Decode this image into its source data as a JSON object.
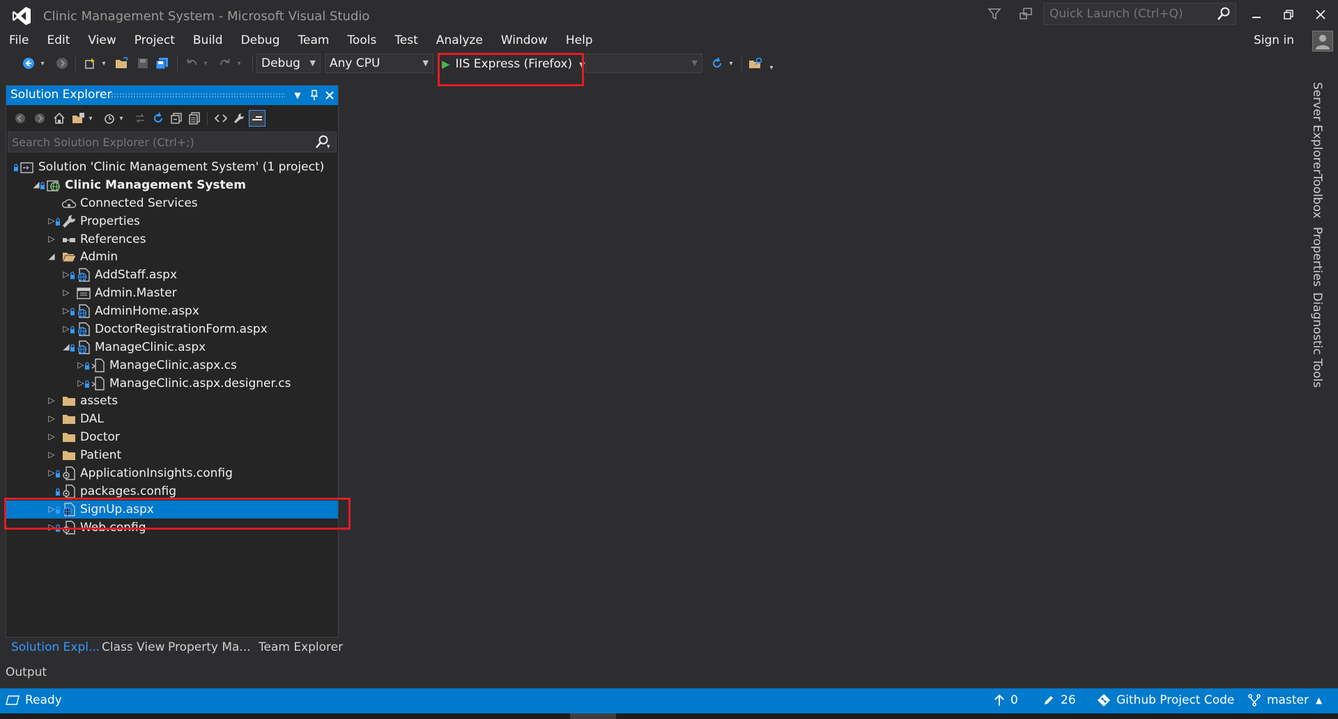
{
  "window": {
    "title": "Clinic Management System - Microsoft Visual Studio",
    "quick_launch_placeholder": "Quick Launch (Ctrl+Q)",
    "sign_in": "Sign in"
  },
  "menu": [
    "File",
    "Edit",
    "View",
    "Project",
    "Build",
    "Debug",
    "Team",
    "Tools",
    "Test",
    "Analyze",
    "Window",
    "Help"
  ],
  "toolbar": {
    "configuration": "Debug",
    "platform": "Any CPU",
    "run_target": "IIS Express (Firefox)"
  },
  "solution_explorer": {
    "title": "Solution Explorer",
    "search_placeholder": "Search Solution Explorer (Ctrl+;)",
    "tree": [
      {
        "label": "Solution 'Clinic Management System' (1 project)",
        "icon": "solution-icon",
        "depth": 0,
        "arrow": "none"
      },
      {
        "label": "Clinic Management System",
        "icon": "web-project-icon",
        "depth": 0,
        "arrow": "expanded",
        "bold": true
      },
      {
        "label": "Connected Services",
        "icon": "cloud-services-icon",
        "depth": 1,
        "arrow": "none"
      },
      {
        "label": "Properties",
        "icon": "wrench-icon",
        "depth": 1,
        "arrow": "collapsed"
      },
      {
        "label": "References",
        "icon": "references-icon",
        "depth": 1,
        "arrow": "collapsed"
      },
      {
        "label": "Admin",
        "icon": "folder-open-icon",
        "depth": 1,
        "arrow": "expanded"
      },
      {
        "label": "AddStaff.aspx",
        "icon": "aspx-file-icon",
        "depth": 2,
        "arrow": "collapsed"
      },
      {
        "label": "Admin.Master",
        "icon": "master-page-icon",
        "depth": 2,
        "arrow": "collapsed"
      },
      {
        "label": "AdminHome.aspx",
        "icon": "aspx-file-icon",
        "depth": 2,
        "arrow": "collapsed"
      },
      {
        "label": "DoctorRegistrationForm.aspx",
        "icon": "aspx-file-icon",
        "depth": 2,
        "arrow": "collapsed"
      },
      {
        "label": "ManageClinic.aspx",
        "icon": "aspx-file-icon",
        "depth": 2,
        "arrow": "expanded"
      },
      {
        "label": "ManageClinic.aspx.cs",
        "icon": "cs-file-icon",
        "depth": 3,
        "arrow": "collapsed"
      },
      {
        "label": "ManageClinic.aspx.designer.cs",
        "icon": "cs-file-icon",
        "depth": 3,
        "arrow": "collapsed"
      },
      {
        "label": "assets",
        "icon": "folder-icon",
        "depth": 1,
        "arrow": "collapsed"
      },
      {
        "label": "DAL",
        "icon": "folder-icon",
        "depth": 1,
        "arrow": "collapsed"
      },
      {
        "label": "Doctor",
        "icon": "folder-icon",
        "depth": 1,
        "arrow": "collapsed"
      },
      {
        "label": "Patient",
        "icon": "folder-icon",
        "depth": 1,
        "arrow": "collapsed"
      },
      {
        "label": "ApplicationInsights.config",
        "icon": "config-file-icon",
        "depth": 1,
        "arrow": "collapsed"
      },
      {
        "label": "packages.config",
        "icon": "config-file-icon",
        "depth": 1,
        "arrow": "none"
      },
      {
        "label": "SignUp.aspx",
        "icon": "aspx-file-icon",
        "depth": 1,
        "arrow": "collapsed",
        "selected": true
      },
      {
        "label": "Web.config",
        "icon": "config-file-icon",
        "depth": 1,
        "arrow": "collapsed"
      }
    ],
    "tabs": [
      "Solution Expl...",
      "Class View",
      "Property Ma...",
      "Team Explorer"
    ]
  },
  "output_tab": "Output",
  "side_tabs": [
    "Server Explorer",
    "Toolbox",
    "Properties",
    "Diagnostic Tools"
  ],
  "status": {
    "text": "Ready",
    "up_count": "0",
    "pending_changes": "26",
    "repo": "Github Project Code",
    "branch": "master"
  },
  "colors": {
    "accent": "#007acc",
    "highlight_box": "#e51c23",
    "background": "#2d2d30",
    "panel": "#252526"
  }
}
